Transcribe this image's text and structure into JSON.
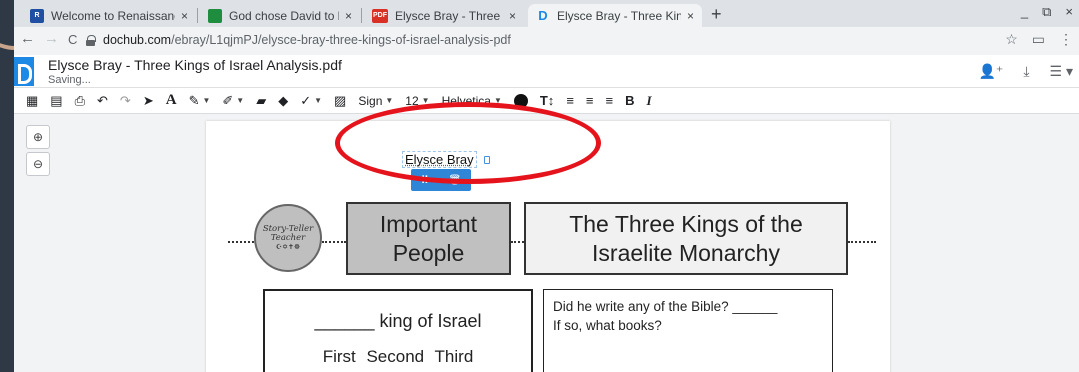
{
  "tabs": [
    {
      "title": "Welcome to Renaissance Place",
      "close": "×",
      "favicon_color": "#1e4fa3",
      "favicon_label": "R"
    },
    {
      "title": "God chose David to lead Israel p",
      "close": "×",
      "favicon_color": "#1e8e3e",
      "favicon_label": ""
    },
    {
      "title": "Elysce Bray - Three Kings of Isra",
      "close": "×",
      "favicon_color": "#d93025",
      "favicon_label": "PDF"
    },
    {
      "title": "Elysce Bray - Three Kings of Isra",
      "close": "×",
      "favicon_color": "#1e88e5",
      "favicon_label": "D"
    }
  ],
  "new_tab": "+",
  "window_controls": {
    "minimize": "_",
    "restore": "⧉",
    "close": "×"
  },
  "nav": {
    "back": "←",
    "forward": "→",
    "reload": "C"
  },
  "url": {
    "host": "dochub.com",
    "path": "/ebray/L1qjmPJ/elysce-bray-three-kings-of-israel-analysis-pdf"
  },
  "nav_right": {
    "star": "☆",
    "cast": "▭",
    "menu": "⋮"
  },
  "app": {
    "title": "Elysce Bray - Three Kings of Israel Analysis.pdf",
    "status": "Saving...",
    "hdr_share": "👤⁺",
    "hdr_download": "⤓",
    "hdr_menu": "☰ ▾"
  },
  "toolbar": {
    "grid": "▦",
    "pages": "▤",
    "print": "⎙",
    "undo": "↶",
    "redo": "↷",
    "select": "➤",
    "text": "A",
    "pen": "✎",
    "highlight": "✐",
    "comment": "▰",
    "eraser": "◆",
    "check": "✓",
    "image": "▨",
    "sign_label": "Sign",
    "font_size": "12",
    "font_name": "Helvetica",
    "text_size_icon": "T↕",
    "align_left": "≡",
    "align_center": "≡",
    "align_right": "≡",
    "bold": "B",
    "italic": "I",
    "dropdown": "▼"
  },
  "zoom": {
    "in": "⊕",
    "out": "⊖"
  },
  "document": {
    "signature_text": "Elysce Bray",
    "sig_move": "⠿",
    "sig_delete": "🗑",
    "stamp_line1": "Story-Teller",
    "stamp_line2": "Teacher",
    "stamp_symbols": "☪✡✝☸",
    "box_important": [
      "Important",
      "People"
    ],
    "box_kings": [
      "The Three Kings of the",
      "Israelite Monarchy"
    ],
    "king_line": "______ king of Israel",
    "ordinals": "First   Second   Third",
    "bible_q1": "Did he write any of the Bible? ______",
    "bible_q2": "If so, what books?"
  }
}
